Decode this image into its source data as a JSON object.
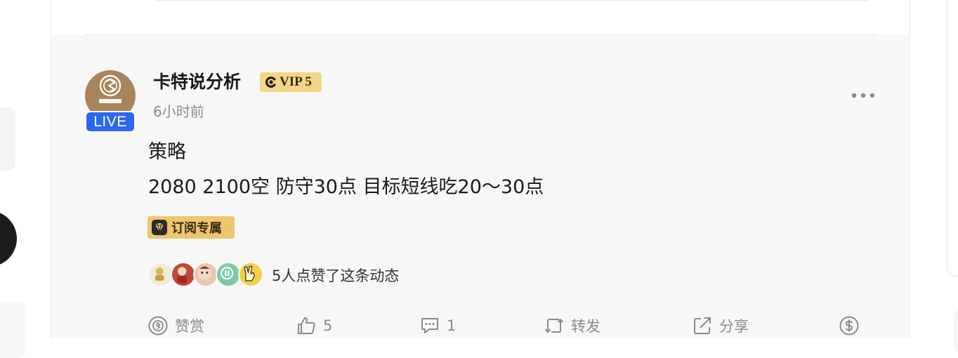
{
  "post": {
    "author_name": "卡特说分析",
    "vip_label": "VIP 5",
    "live_label": "LIVE",
    "time": "6小时前",
    "content_line1": "策略",
    "content_line2": "2080 2100空 防守30点 目标短线吃20～30点",
    "subscription_tag": "订阅专属",
    "likes_text": "5人点赞了这条动态"
  },
  "actions": {
    "reward_label": "赞赏",
    "like_count": "5",
    "comment_count": "1",
    "repost_label": "转发",
    "share_label": "分享"
  },
  "icons": [
    "more-icon",
    "reward-icon",
    "like-icon",
    "comment-icon",
    "repost-icon",
    "share-icon",
    "dollar-icon",
    "vip-icon",
    "diamond-icon"
  ],
  "colors": {
    "live_blue": "#2a69ef",
    "vip_gold": "#f3d686",
    "subscription_gold": "#edc66d",
    "post_background": "#f7f7f7",
    "action_gray": "#8a8a8a"
  }
}
